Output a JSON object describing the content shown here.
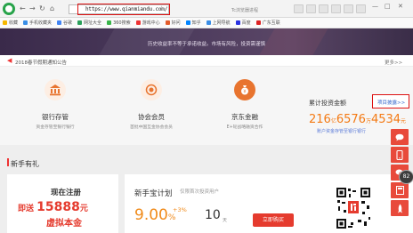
{
  "browser": {
    "address": "https://www.qianmiandu.com/",
    "search_label": "Tc浏览器进程",
    "back": "←",
    "forward": "→",
    "refresh": "↻",
    "home": "⌂",
    "star": "☆",
    "minimize": "—",
    "maximize": "□",
    "close": "✕"
  },
  "bookmarks": [
    {
      "label": "收藏",
      "color": "#f5b700"
    },
    {
      "label": "手机收藏夹",
      "color": "#3a8ee6"
    },
    {
      "label": "谷歌",
      "color": "#4285f4"
    },
    {
      "label": "网址大全",
      "color": "#2aa05a"
    },
    {
      "label": "360搜索",
      "color": "#39b54a"
    },
    {
      "label": "游戏中心",
      "color": "#e33"
    },
    {
      "label": "好问",
      "color": "#e35c2b"
    },
    {
      "label": "知乎",
      "color": "#0084ff"
    },
    {
      "label": "上网导航",
      "color": "#3a8ee6"
    },
    {
      "label": "百度",
      "color": "#2932e1"
    },
    {
      "label": "广东互联",
      "color": "#d22"
    }
  ],
  "banner": {
    "tagline": "历史收益率不等于承诺收益。市场有风险，投资需谨慎"
  },
  "notice": {
    "text": "2018春节假期通知公告",
    "more": "更多>>"
  },
  "features": [
    {
      "title": "银行存管",
      "desc": "资金存管至银行银行",
      "color": "#e8742f"
    },
    {
      "title": "协会会员",
      "desc": "首批中国互金协会会员",
      "color": "#e8742f"
    },
    {
      "title": "京东金融",
      "desc": "E+轮战略融资合作",
      "color": "#e8742f"
    }
  ],
  "cumulative": {
    "title": "累计投资金额",
    "view_label": "项目披露>>",
    "amount_parts": [
      "216",
      "亿",
      "6576",
      "万",
      "4534",
      "元"
    ],
    "note": "账户资金存管至银行银行"
  },
  "newbie": {
    "title": "新手有礼",
    "register": {
      "line1": "现在注册",
      "prefix": "即送",
      "amount": "15888",
      "unit": "元",
      "line3": "虚拟本金"
    },
    "plan": {
      "name": "新手宝计划",
      "tag": "仅限首次投资用户",
      "rate": "9.00",
      "rate_unit": "%",
      "bonus": "+3%",
      "days": "10",
      "days_unit": "天",
      "buy_label": "立即购买"
    }
  },
  "float": {
    "badge": "82"
  }
}
